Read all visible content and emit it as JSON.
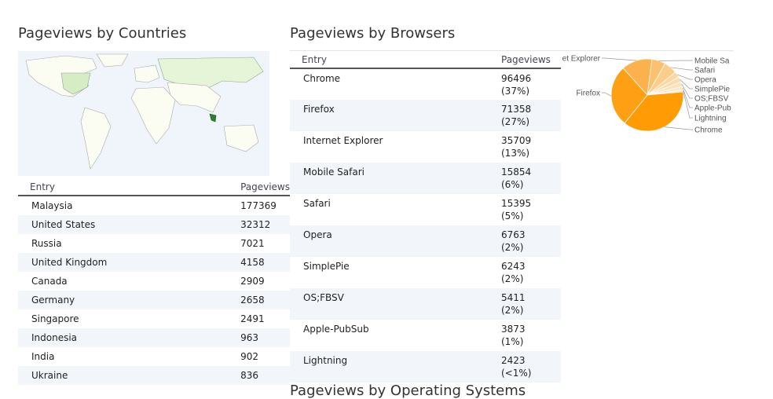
{
  "countries": {
    "title": "Pageviews by Countries",
    "col_entry": "Entry",
    "col_pageviews": "Pageviews",
    "rows": [
      {
        "entry": "Malaysia",
        "pageviews": "177369"
      },
      {
        "entry": "United States",
        "pageviews": "32312"
      },
      {
        "entry": "Russia",
        "pageviews": "7021"
      },
      {
        "entry": "United Kingdom",
        "pageviews": "4158"
      },
      {
        "entry": "Canada",
        "pageviews": "2909"
      },
      {
        "entry": "Germany",
        "pageviews": "2658"
      },
      {
        "entry": "Singapore",
        "pageviews": "2491"
      },
      {
        "entry": "Indonesia",
        "pageviews": "963"
      },
      {
        "entry": "India",
        "pageviews": "902"
      },
      {
        "entry": "Ukraine",
        "pageviews": "836"
      }
    ]
  },
  "browsers": {
    "title": "Pageviews by Browsers",
    "col_entry": "Entry",
    "col_pageviews": "Pageviews",
    "rows": [
      {
        "entry": "Chrome",
        "pageviews": "96496",
        "percent": "(37%)"
      },
      {
        "entry": "Firefox",
        "pageviews": "71358",
        "percent": "(27%)"
      },
      {
        "entry": "Internet Explorer",
        "pageviews": "35709",
        "percent": "(13%)"
      },
      {
        "entry": "Mobile Safari",
        "pageviews": "15854",
        "percent": "(6%)"
      },
      {
        "entry": "Safari",
        "pageviews": "15395",
        "percent": "(5%)"
      },
      {
        "entry": "Opera",
        "pageviews": "6763",
        "percent": "(2%)"
      },
      {
        "entry": "SimplePie",
        "pageviews": "6243",
        "percent": "(2%)"
      },
      {
        "entry": "OS;FBSV",
        "pageviews": "5411",
        "percent": "(2%)"
      },
      {
        "entry": "Apple-PubSub",
        "pageviews": "3873",
        "percent": "(1%)"
      },
      {
        "entry": "Lightning",
        "pageviews": "2423",
        "percent": "(<1%)"
      }
    ]
  },
  "os_section": {
    "title": "Pageviews by Operating Systems"
  },
  "colors": {
    "pie_dark": "#ff9900",
    "pie_light": "#fde3b8",
    "map_highlight": "#d6ecc4",
    "map_top": "#2e7d32"
  },
  "chart_data": {
    "type": "pie",
    "categories": [
      "Internet Explorer",
      "Mobile Safari",
      "Safari",
      "Opera",
      "SimplePie",
      "OS;FBSV",
      "Apple-PubSub",
      "Lightning",
      "Chrome",
      "Firefox"
    ],
    "values": [
      35709,
      15854,
      15395,
      6763,
      6243,
      5411,
      3873,
      2423,
      96496,
      71358
    ],
    "labels": [
      "et Explorer",
      "Mobile Sa",
      "Safari",
      "Opera",
      "SimplePie",
      "OS;FBSV",
      "Apple-Pub",
      "Lightning",
      "Chrome",
      "Firefox"
    ]
  }
}
